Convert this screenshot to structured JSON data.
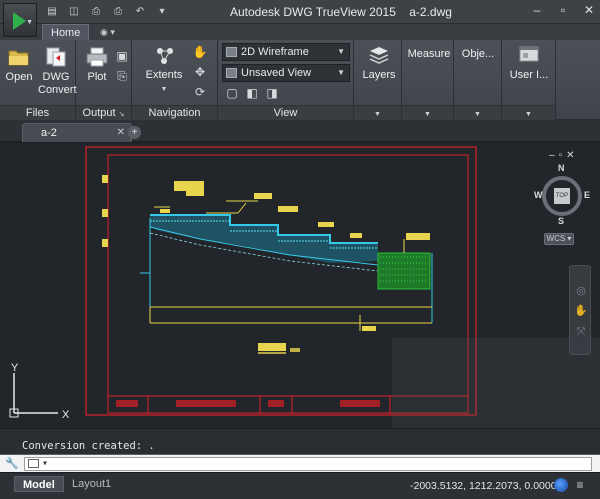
{
  "window": {
    "title": "Autodesk DWG TrueView 2015",
    "filename": "a-2.dwg"
  },
  "ribbon": {
    "tabs": [
      "Home"
    ],
    "groups": {
      "files": {
        "label": "Files",
        "open": "Open",
        "dwg_convert_1": "DWG",
        "dwg_convert_2": "Convert"
      },
      "output": {
        "label": "Output",
        "plot": "Plot"
      },
      "navigation": {
        "label": "Navigation",
        "extents": "Extents"
      },
      "view": {
        "label": "View",
        "visual_style": "2D Wireframe",
        "named_view": "Unsaved View"
      },
      "layers": {
        "label": "Layers"
      },
      "measure": {
        "label": "Measure"
      },
      "objects": {
        "label": "Obje..."
      },
      "user_interface": {
        "label": "User I..."
      }
    }
  },
  "document_tab": {
    "label": "a-2"
  },
  "viewcube": {
    "top": "TOP",
    "north": "N",
    "south": "S",
    "east": "E",
    "west": "W",
    "wcs": "WCS"
  },
  "ucs": {
    "x": "X",
    "y": "Y"
  },
  "command": {
    "history": "Conversion created: .",
    "input_placeholder": ""
  },
  "status": {
    "layouts": [
      "Model",
      "Layout1"
    ],
    "coordinates": "-2003.5132, 1212.2073, 0.0000"
  },
  "colors": {
    "canvas": "#22262a",
    "border_red": "#d9202a",
    "drawing_cyan": "#36c8e8",
    "drawing_yellow": "#e8d44d",
    "drawing_green": "#2bbf3a",
    "accent_green": "#2fb04a"
  },
  "icons": [
    "app-logo",
    "open-folder",
    "dwg-convert",
    "plot-printer",
    "extents",
    "pan-hand",
    "orbit",
    "layers",
    "user-interface",
    "wrench",
    "globe"
  ]
}
